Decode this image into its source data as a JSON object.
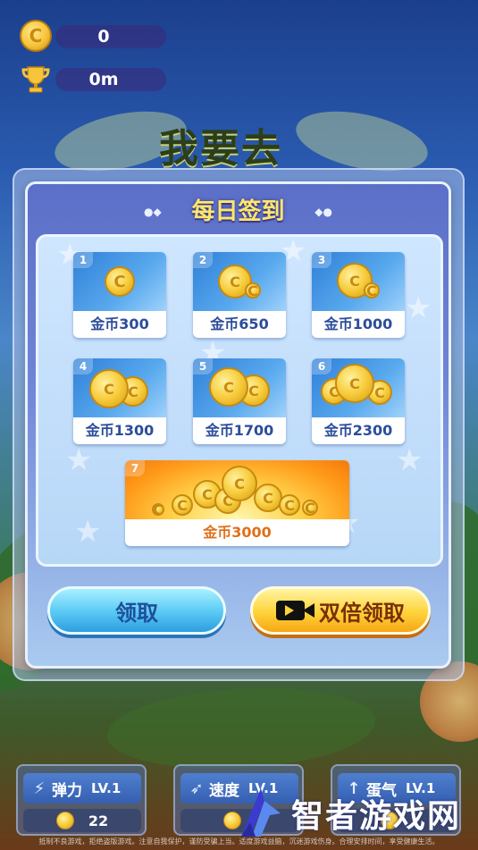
{
  "hud": {
    "coins": "0",
    "distance": "0m"
  },
  "background": {
    "game_title": "我要去"
  },
  "dialog": {
    "title": "每日签到",
    "rewards": [
      {
        "day": "1",
        "label": "金币300"
      },
      {
        "day": "2",
        "label": "金币650"
      },
      {
        "day": "3",
        "label": "金币1000"
      },
      {
        "day": "4",
        "label": "金币1300"
      },
      {
        "day": "5",
        "label": "金币1700"
      },
      {
        "day": "6",
        "label": "金币2300"
      },
      {
        "day": "7",
        "label": "金币3000"
      }
    ],
    "claim_label": "领取",
    "double_claim_label": "双倍领取"
  },
  "upgrades": [
    {
      "name": "弹力",
      "level": "LV.1",
      "cost": "22"
    },
    {
      "name": "速度",
      "level": "LV.1",
      "cost": ""
    },
    {
      "name": "蛋气",
      "level": "LV.1",
      "cost": ""
    }
  ],
  "watermark": {
    "text": "智者游戏网"
  },
  "footer": {
    "disclaimer": "抵制不良游戏，拒绝盗版游戏。注意自我保护，谨防受骗上当。适度游戏益脑，沉迷游戏伤身。合理安排时间，享受健康生活。"
  },
  "colors": {
    "title_yellow": "#ffe76a",
    "claim_blue": "#58c8f4",
    "double_orange": "#ffd33a"
  }
}
